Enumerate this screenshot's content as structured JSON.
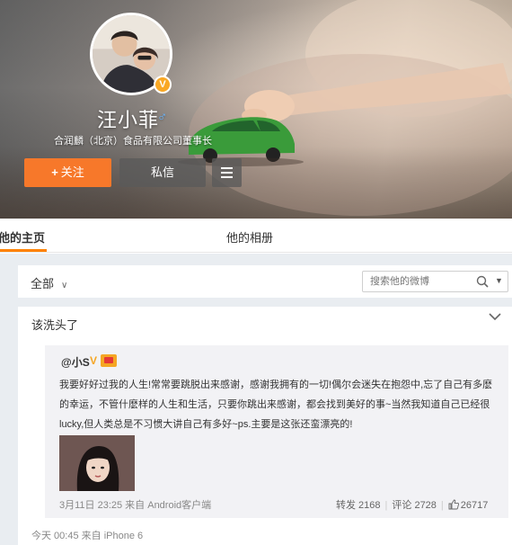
{
  "profile": {
    "name": "汪小菲",
    "gender_symbol": "♂",
    "verified_badge": "V",
    "bio": "合润麟（北京）食品有限公司董事长"
  },
  "actions": {
    "follow_plus": "+",
    "follow_label": "关注",
    "message_label": "私信"
  },
  "tabs": {
    "home": "他的主页",
    "album": "他的相册"
  },
  "filter": {
    "all_label": "全部",
    "search_placeholder": "搜索他的微博"
  },
  "post": {
    "text": "该洗头了",
    "meta": "今天 00:45 来自 iPhone 6",
    "repost": {
      "user": "@小S",
      "text": "我要好好过我的人生!常常要跳脱出来感谢，感谢我拥有的一切!偶尔会迷失在抱怨中,忘了自己有多麽的幸运，不管什麽样的人生和生活，只要你跳出来感谢，都会找到美好的事~当然我知道自己已经很lucky,但人类总是不习惯大讲自己有多好~ps.主要是这张还蛮漂亮的!",
      "meta": "3月11日 23:25 来自 Android客户端",
      "repost_count": "转发 2168",
      "comment_count": "评论 2728",
      "like_count": "26717"
    }
  },
  "colors": {
    "accent_orange": "#f7782a",
    "tab_underline": "#ff8200",
    "gender_blue": "#6ab6ff",
    "vip_gold": "#f5a623"
  }
}
